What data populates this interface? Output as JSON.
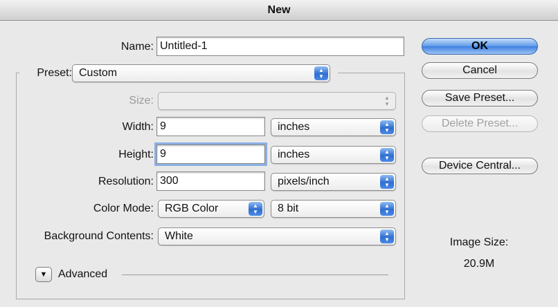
{
  "window": {
    "title": "New"
  },
  "form": {
    "name": {
      "label": "Name:",
      "value": "Untitled-1"
    },
    "preset": {
      "label": "Preset:",
      "value": "Custom"
    },
    "size": {
      "label": "Size:",
      "value": ""
    },
    "width": {
      "label": "Width:",
      "value": "9",
      "unit": "inches"
    },
    "height": {
      "label": "Height:",
      "value": "9",
      "unit": "inches"
    },
    "resolution": {
      "label": "Resolution:",
      "value": "300",
      "unit": "pixels/inch"
    },
    "color_mode": {
      "label": "Color Mode:",
      "value": "RGB Color",
      "depth": "8 bit"
    },
    "background": {
      "label": "Background Contents:",
      "value": "White"
    },
    "advanced": {
      "label": "Advanced"
    }
  },
  "buttons": {
    "ok": "OK",
    "cancel": "Cancel",
    "save_preset": "Save Preset...",
    "delete_preset": "Delete Preset...",
    "device_central": "Device Central..."
  },
  "image_size": {
    "label": "Image Size:",
    "value": "20.9M"
  },
  "icons": {
    "popup_arrows": "up-down-arrows-icon",
    "disclosure": "disclosure-triangle-icon"
  }
}
